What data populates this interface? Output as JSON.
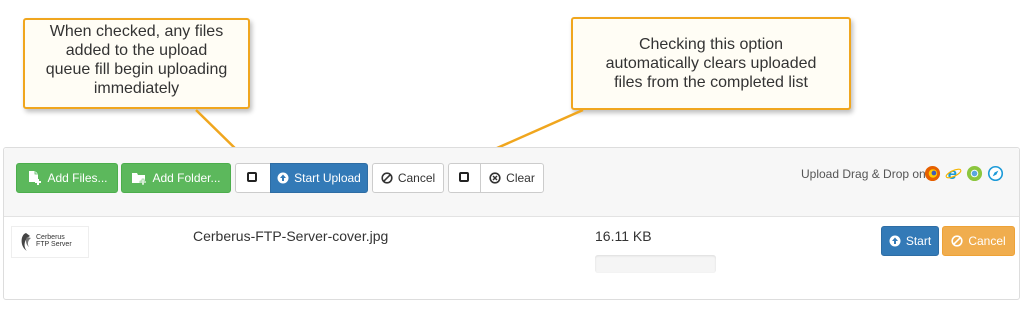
{
  "callouts": {
    "auto_upload": [
      "When checked, any files",
      "added to the upload",
      "queue fill begin uploading",
      "immediately"
    ],
    "auto_clear": [
      "Checking this option",
      "automatically clears uploaded",
      "files from the completed list"
    ]
  },
  "toolbar": {
    "add_files_label": "Add Files...",
    "add_folder_label": "Add Folder...",
    "start_upload_label": "Start Upload",
    "cancel_label": "Cancel",
    "clear_label": "Clear",
    "auto_upload_checked": false,
    "auto_clear_checked": false,
    "drag_drop_label": "Upload Drag & Drop on",
    "browsers": [
      "firefox-icon",
      "ie-icon",
      "chrome-icon",
      "safari-icon"
    ]
  },
  "queue": {
    "files": [
      {
        "thumb_text": [
          "Cerberus",
          "FTP Server"
        ],
        "name": "Cerberus-FTP-Server-cover.jpg",
        "size": "16.11 KB",
        "progress": 0,
        "start_label": "Start",
        "cancel_label": "Cancel"
      }
    ]
  },
  "colors": {
    "accent_orange": "#f0a61e",
    "green": "#5cb85c",
    "blue": "#337ab7",
    "orange_button": "#f0ad4e"
  }
}
